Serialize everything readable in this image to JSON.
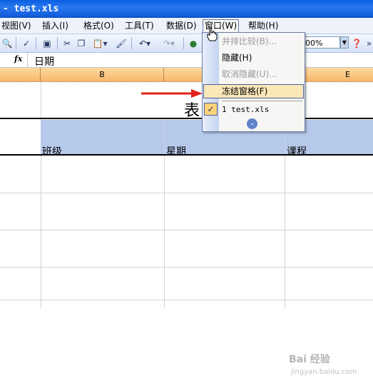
{
  "window": {
    "title": "- test.xls"
  },
  "menu": {
    "items": [
      {
        "id": "view",
        "label": "视图(V)"
      },
      {
        "id": "insert",
        "label": "插入(I)"
      },
      {
        "id": "format",
        "label": "格式(O)"
      },
      {
        "id": "tools",
        "label": "工具(T)"
      },
      {
        "id": "data",
        "label": "数据(D)"
      },
      {
        "id": "window",
        "label": "窗口(W)"
      },
      {
        "id": "help",
        "label": "帮助(H)"
      }
    ]
  },
  "toolbar": {
    "zoom_value": "00%"
  },
  "formula_bar": {
    "fx_label": "fx",
    "value": "日期"
  },
  "columns": [
    "B",
    "E"
  ],
  "sheet": {
    "title_cell": "表",
    "header_labels": [
      "班级",
      "星期",
      "课程"
    ]
  },
  "window_menu": {
    "items": [
      {
        "label": "并排比较(B)...",
        "disabled": true
      },
      {
        "label": "隐藏(H)",
        "disabled": false
      },
      {
        "label": "取消隐藏(U)...",
        "disabled": true
      },
      {
        "label": "冻结窗格(F)",
        "disabled": false,
        "highlighted": true
      },
      {
        "label": "1 test.xls",
        "disabled": false,
        "checked": true
      }
    ],
    "check_glyph": "✓",
    "expand_glyph": "⌄"
  },
  "watermark": {
    "text": "Bai 经验",
    "sub": "jingyan.baidu.com"
  }
}
